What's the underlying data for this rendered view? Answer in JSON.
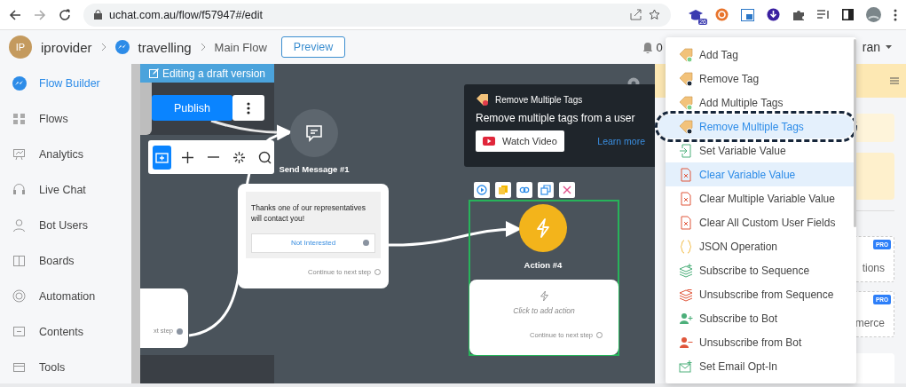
{
  "browser": {
    "url": "uchat.com.au/flow/f57947#/edit",
    "extension_badge": "26"
  },
  "header": {
    "avatar": "IP",
    "workspace": "iprovider",
    "bot": "travelling",
    "flow": "Main Flow",
    "preview_button": "Preview",
    "notifications": "0",
    "user": "ran"
  },
  "sidebar": {
    "items": [
      {
        "label": "Flow Builder",
        "kind": "flow",
        "selected": true
      },
      {
        "label": "Flows",
        "kind": "grid",
        "selected": false
      },
      {
        "label": "Analytics",
        "kind": "chart",
        "selected": false
      },
      {
        "label": "Live Chat",
        "kind": "headset",
        "selected": false
      },
      {
        "label": "Bot Users",
        "kind": "user",
        "selected": false
      },
      {
        "label": "Boards",
        "kind": "board",
        "selected": false
      },
      {
        "label": "Automation",
        "kind": "ring",
        "selected": false
      },
      {
        "label": "Contents",
        "kind": "content",
        "selected": false
      },
      {
        "label": "Tools",
        "kind": "tools",
        "selected": false
      }
    ]
  },
  "canvas": {
    "draft_banner": "Editing a draft version",
    "publish_button": "Publish",
    "left_card_text": "xt step",
    "send_message": {
      "title": "Send Message #1",
      "text": "Thanks one of our representatives will contact you!",
      "button": "Not Interested",
      "continue": "Continue to next step"
    },
    "action": {
      "title": "Action #4",
      "prompt": "Click to add action",
      "continue": "Continue to next step",
      "selected": true
    },
    "tooltip": {
      "title": "Remove Multiple Tags",
      "description": "Remove multiple tags from a user",
      "video_button": "Watch Video",
      "link": "Learn more"
    }
  },
  "side_panel": {
    "cards": [
      {
        "badge": "PRO",
        "text": "tions"
      },
      {
        "badge": "PRO",
        "text": "merce"
      }
    ]
  },
  "action_menu": {
    "items": [
      {
        "label": "Add Tag",
        "kind": "tag-add",
        "highlighted": false,
        "outlined": false
      },
      {
        "label": "Remove Tag",
        "kind": "tag-remove",
        "highlighted": false,
        "outlined": false
      },
      {
        "label": "Add Multiple Tags",
        "kind": "tag-add",
        "highlighted": false,
        "outlined": false
      },
      {
        "label": "Remove Multiple Tags",
        "kind": "tag-remove",
        "highlighted": true,
        "outlined": true
      },
      {
        "label": "Set Variable Value",
        "kind": "variable-set",
        "highlighted": false,
        "outlined": false
      },
      {
        "label": "Clear Variable Value",
        "kind": "variable-clear",
        "highlighted": true,
        "outlined": false
      },
      {
        "label": "Clear Multiple Variable Value",
        "kind": "variable-clear",
        "highlighted": false,
        "outlined": false
      },
      {
        "label": "Clear All Custom User Fields",
        "kind": "variable-clear",
        "highlighted": false,
        "outlined": false
      },
      {
        "label": "JSON Operation",
        "kind": "json",
        "highlighted": false,
        "outlined": false
      },
      {
        "label": "Subscribe to Sequence",
        "kind": "sequence-add",
        "highlighted": false,
        "outlined": false
      },
      {
        "label": "Unsubscribe from Sequence",
        "kind": "sequence-remove",
        "highlighted": false,
        "outlined": false
      },
      {
        "label": "Subscribe to Bot",
        "kind": "bot-add",
        "highlighted": false,
        "outlined": false
      },
      {
        "label": "Unsubscribe from Bot",
        "kind": "bot-remove",
        "highlighted": false,
        "outlined": false
      },
      {
        "label": "Set Email Opt-In",
        "kind": "email",
        "highlighted": false,
        "outlined": false
      }
    ]
  }
}
